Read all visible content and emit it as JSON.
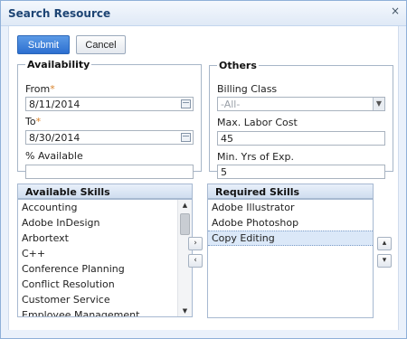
{
  "dialog": {
    "title": "Search Resource",
    "close_icon": "×"
  },
  "toolbar": {
    "submit_label": "Submit",
    "cancel_label": "Cancel"
  },
  "availability": {
    "legend": "Availability",
    "from_label": "From",
    "from_value": "8/11/2014",
    "to_label": "To",
    "to_value": "8/30/2014",
    "percent_label": "% Available",
    "percent_value": "",
    "required_marker": "*"
  },
  "others": {
    "legend": "Others",
    "billing_label": "Billing Class",
    "billing_value": "-All-",
    "max_labor_label": "Max. Labor Cost",
    "max_labor_value": "45",
    "min_yrs_label": "Min. Yrs of Exp.",
    "min_yrs_value": "5"
  },
  "available_skills": {
    "header": "Available Skills",
    "items": [
      "Accounting",
      "Adobe InDesign",
      "Arbortext",
      "C++",
      "Conference Planning",
      "Conflict Resolution",
      "Customer Service",
      "Employee Management"
    ],
    "scroll_position": 0.08
  },
  "required_skills": {
    "header": "Required Skills",
    "items": [
      "Adobe Illustrator",
      "Adobe Photoshop",
      "Copy Editing"
    ],
    "selected_index": 2
  },
  "transfer": {
    "move_right_icon": "›",
    "move_left_icon": "‹"
  },
  "order": {
    "move_up_icon": "▴",
    "move_down_icon": "▾"
  },
  "colors": {
    "accent": "#2c6fd0",
    "title_text": "#1d4474",
    "required_marker": "#d9822b",
    "selected_row": "#dbe8f8"
  }
}
